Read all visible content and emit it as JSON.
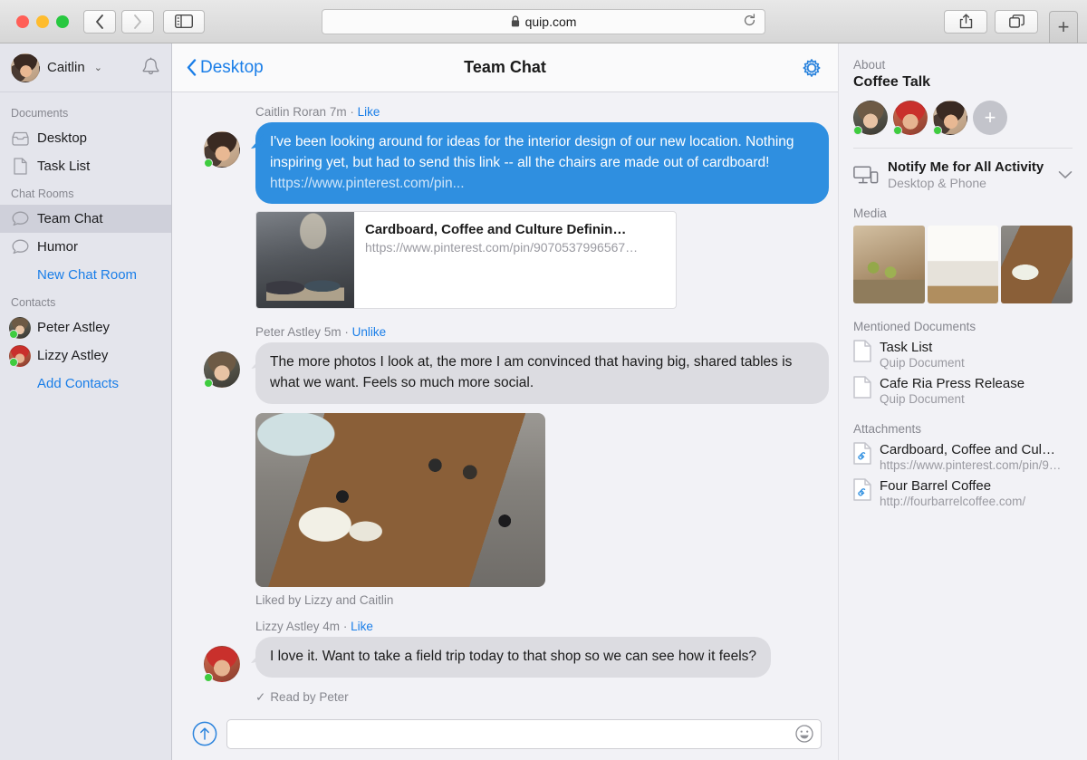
{
  "browser": {
    "url": "quip.com",
    "back_label": "Back",
    "forward_label": "Forward",
    "sidebar_toggle_label": "Show Sidebar",
    "reload_label": "Reload",
    "share_label": "Share",
    "tabs_label": "Show Tabs",
    "newtab_label": "+"
  },
  "sidebar": {
    "user": {
      "name": "Caitlin",
      "chevron": "⌄"
    },
    "notifications_label": "Notifications",
    "sections": [
      {
        "label": "Documents",
        "items": [
          {
            "label": "Desktop",
            "icon": "inbox-icon",
            "selected": false
          },
          {
            "label": "Task List",
            "icon": "document-icon",
            "selected": false
          }
        ]
      },
      {
        "label": "Chat Rooms",
        "items": [
          {
            "label": "Team Chat",
            "icon": "chat-bubble-icon",
            "selected": true
          },
          {
            "label": "Humor",
            "icon": "chat-bubble-icon",
            "selected": false
          }
        ],
        "link": "New Chat Room"
      },
      {
        "label": "Contacts",
        "items": [
          {
            "label": "Peter Astley",
            "icon": "avatar",
            "selected": false
          },
          {
            "label": "Lizzy Astley",
            "icon": "avatar",
            "selected": false
          }
        ],
        "link": "Add Contacts"
      }
    ]
  },
  "chat": {
    "back_label": "Desktop",
    "title": "Team Chat",
    "settings_label": "Settings",
    "messages": [
      {
        "author": "Caitlin Roran",
        "time": "7m",
        "separator": "·",
        "like_action": "Like",
        "text": "I've been looking around for ideas for the interior design of our new location. Nothing inspiring yet, but had to send this link -- all the chairs are made out of cardboard! ",
        "inline_url": "https://www.pinterest.com/pin...",
        "own": true,
        "link_card": {
          "title": "Cardboard, Coffee and Culture Definin…",
          "url": "https://www.pinterest.com/pin/9070537996567…"
        }
      },
      {
        "author": "Peter Astley",
        "time": "5m",
        "separator": "·",
        "like_action": "Unlike",
        "text": "The more photos I look at, the more I am convinced that having big, shared tables is what we want. Feels so much more social.",
        "own": false,
        "photo": true,
        "liked_by": "Liked by Lizzy and Caitlin"
      },
      {
        "author": "Lizzy Astley",
        "time": "4m",
        "separator": "·",
        "like_action": "Like",
        "text": "I love it. Want to take a field trip today to that shop so we can see how it feels?",
        "own": false
      }
    ],
    "read_receipt": "Read by Peter",
    "read_check": "✓",
    "composer": {
      "value": "",
      "placeholder": "",
      "send_label": "Send",
      "emoji_label": "Emoji"
    }
  },
  "right_panel": {
    "about_label": "About",
    "room_name": "Coffee Talk",
    "members": [
      {
        "name": "Peter Astley",
        "online": true
      },
      {
        "name": "Lizzy Astley",
        "online": true
      },
      {
        "name": "Caitlin Roran",
        "online": true
      }
    ],
    "add_member_label": "+",
    "notify": {
      "title": "Notify Me for All Activity",
      "subtitle": "Desktop & Phone",
      "chevron": "⌄"
    },
    "media_label": "Media",
    "media": [
      {
        "alt": "Coffee bar with stools"
      },
      {
        "alt": "Bright cafe interior"
      },
      {
        "alt": "Wooden communal table"
      }
    ],
    "mentioned_label": "Mentioned Documents",
    "mentioned_documents": [
      {
        "title": "Task List",
        "subtitle": "Quip Document"
      },
      {
        "title": "Cafe Ria Press Release",
        "subtitle": "Quip Document"
      }
    ],
    "attachments_label": "Attachments",
    "attachments": [
      {
        "title": "Cardboard, Coffee and Cul…",
        "subtitle": "https://www.pinterest.com/pin/9…"
      },
      {
        "title": "Four Barrel Coffee",
        "subtitle": "http://fourbarrelcoffee.com/"
      }
    ]
  },
  "colors": {
    "accent_blue": "#1a7ee8",
    "bubble_blue": "#2f8fe0",
    "bubble_gray": "#dcdce1",
    "online_green": "#3fcc3f",
    "sidebar_bg": "#e4e5ec"
  }
}
